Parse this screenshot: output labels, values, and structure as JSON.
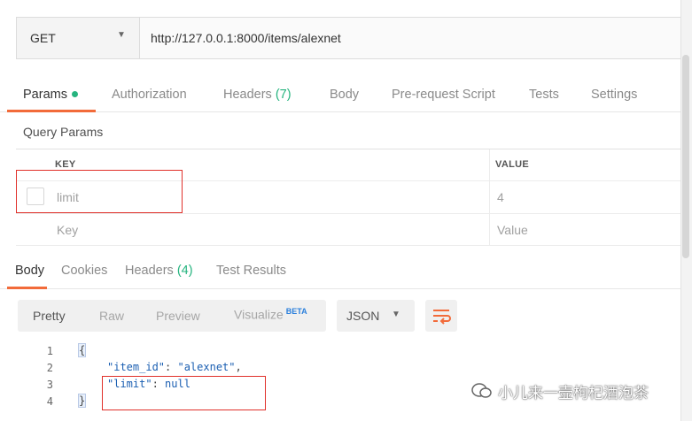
{
  "request": {
    "method": "GET",
    "url": "http://127.0.0.1:8000/items/alexnet"
  },
  "tabs": [
    {
      "label": "Params",
      "active": true
    },
    {
      "label": "Authorization"
    },
    {
      "label": "Headers",
      "count": "(7)"
    },
    {
      "label": "Body"
    },
    {
      "label": "Pre-request Script"
    },
    {
      "label": "Tests"
    },
    {
      "label": "Settings"
    }
  ],
  "query_params": {
    "title": "Query Params",
    "headers": [
      "KEY",
      "VALUE"
    ],
    "rows": [
      {
        "key": "limit",
        "value": "4"
      }
    ],
    "placeholder_key": "Key",
    "placeholder_value": "Value"
  },
  "response_tabs": [
    {
      "label": "Body",
      "active": true
    },
    {
      "label": "Cookies"
    },
    {
      "label": "Headers",
      "count": "(4)"
    },
    {
      "label": "Test Results"
    }
  ],
  "body_toolbar": {
    "modes": [
      "Pretty",
      "Raw",
      "Preview",
      "Visualize"
    ],
    "beta": "BETA",
    "format": "JSON"
  },
  "code": {
    "line_numbers": [
      "1",
      "2",
      "3",
      "4"
    ],
    "open": "{",
    "close": "}",
    "lines": [
      {
        "key": "\"item_id\"",
        "value": "\"alexnet\"",
        "comma": ","
      },
      {
        "key": "\"limit\"",
        "value": "null",
        "comma": ""
      }
    ]
  },
  "watermark": "小儿来一壶枸杞酒泡茶",
  "colors": {
    "accent": "#f26b3a",
    "green": "#26b47f",
    "highlight": "#e0302a"
  }
}
